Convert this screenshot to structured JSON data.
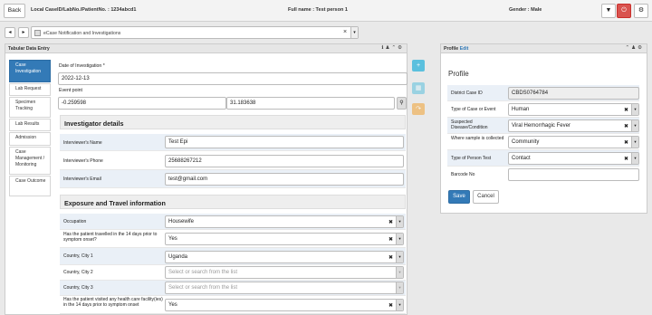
{
  "topbar": {
    "back_label": "Back",
    "case_info": "Local CaseID/LabNo./PatientNo. : 1234abcd1",
    "full_name": "Full name : Test person 1",
    "gender": "Gender : Male"
  },
  "navbar": {
    "prev_label": "◂",
    "next_label": "▸",
    "selected_tab": "eCase Notification and Investigations"
  },
  "tabular_panel": {
    "title": "Tabular Data Entry",
    "icons": [
      "info-icon",
      "user-icon",
      "chevron-up-icon",
      "gear-icon"
    ]
  },
  "sidenav": {
    "items": [
      {
        "label": "Case Investigation",
        "active": true
      },
      {
        "label": "Lab Request"
      },
      {
        "label": "Specimen Tracking"
      },
      {
        "label": "Lab Results"
      },
      {
        "label": "Admission"
      },
      {
        "label": "Case Management / Monitoring"
      },
      {
        "label": "Case Outcome"
      }
    ]
  },
  "form": {
    "date_label": "Date of Investigation *",
    "date_value": "2022-12-13",
    "event_point_label": "Event point",
    "longitude": "-0.259598",
    "latitude": "31.183638",
    "investigator_section": "Investigator details",
    "investigator": [
      {
        "label": "Interviewer's Name",
        "value": "Test Epi"
      },
      {
        "label": "Interviewer's Phone",
        "value": "25688267212"
      },
      {
        "label": "Interviewer's Email",
        "value": "test@gmail.com"
      }
    ],
    "exposure_section": "Exposure and Travel information",
    "exposure": [
      {
        "label": "Occupation",
        "value": "Housewife",
        "placeholder": false
      },
      {
        "label": "Has the patient travelled in the 14 days prior to symptom onset?",
        "value": "Yes",
        "placeholder": false
      },
      {
        "label": "Country, City 1",
        "value": "Uganda",
        "placeholder": false
      },
      {
        "label": "Country, City 2",
        "value": "Select or search from the list",
        "placeholder": true
      },
      {
        "label": "Country, City 3",
        "value": "Select or search from the list",
        "placeholder": true
      },
      {
        "label": "Has the patient visited any health care facility(ies) in the 14 days prior to symptom onset",
        "value": "Yes",
        "placeholder": false
      }
    ]
  },
  "side_buttons": {
    "add": "+",
    "calendar": "▦",
    "share": "↷"
  },
  "profile_panel": {
    "title": "Profile",
    "edit_label": "Edit",
    "heading": "Profile",
    "fields": [
      {
        "label": "District Case ID",
        "value": "CBDS0764784"
      },
      {
        "label": "Type of Case or Event",
        "value": "Human"
      },
      {
        "label": "Suspected Disease/Condition",
        "value": "Viral Hemorrhagic Fever"
      },
      {
        "label": "Where sample is collected",
        "value": "Community"
      },
      {
        "label": "Type of Person Test",
        "value": "Contact"
      },
      {
        "label": "Barcode No",
        "value": ""
      }
    ],
    "save_label": "Save",
    "cancel_label": "Cancel"
  },
  "colors": {
    "primary": "#337ab7",
    "danger": "#d9534f",
    "info": "#5bc0de",
    "warning": "#f0ad4e"
  }
}
